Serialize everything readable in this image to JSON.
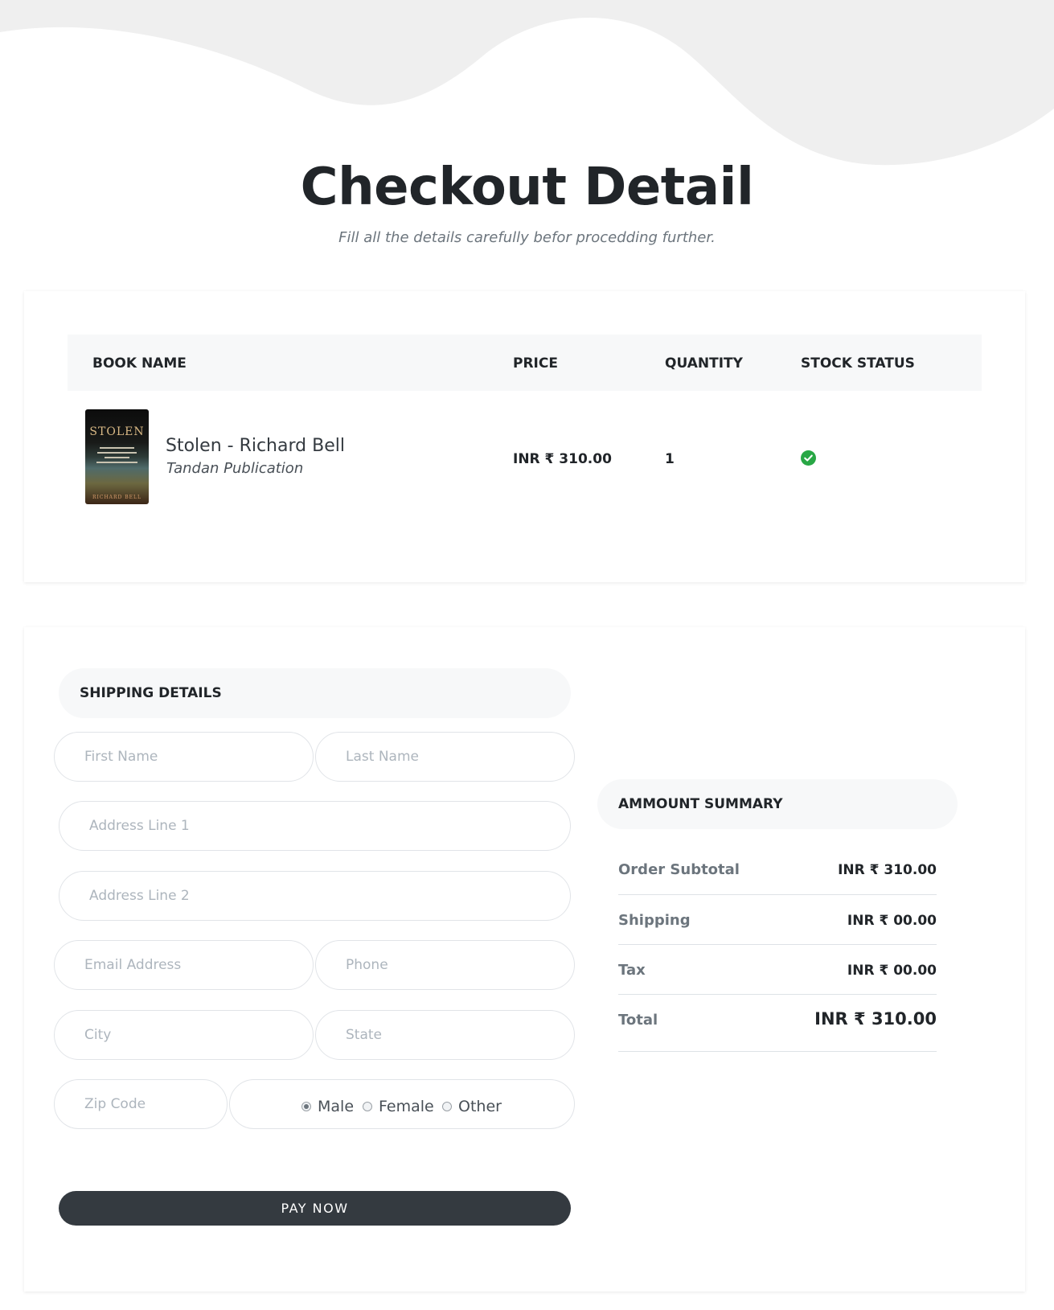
{
  "header": {
    "title": "Checkout Detail",
    "subtitle": "Fill all the details carefully befor procedding further."
  },
  "cart": {
    "columns": [
      "BOOK NAME",
      "PRICE",
      "QUANTITY",
      "STOCK STATUS"
    ],
    "item": {
      "name": "Stolen - Richard Bell",
      "publisher": "Tandan Publication",
      "price": "INR ₹ 310.00",
      "quantity": "1",
      "stock_status_icon": "check-circle-icon",
      "stock_status_color": "#28a745",
      "cover": {
        "title": "STOLEN",
        "author": "RICHARD BELL"
      }
    }
  },
  "shipping": {
    "heading": "SHIPPING DETAILS",
    "placeholders": {
      "first_name": "First Name",
      "last_name": "Last Name",
      "address1": "Address Line 1",
      "address2": "Address Line 2",
      "email": "Email Address",
      "phone": "Phone",
      "city": "City",
      "state": "State",
      "zip": "Zip Code"
    },
    "gender_options": [
      "Male",
      "Female",
      "Other"
    ],
    "gender_selected": "Male",
    "pay_button": "PAY NOW"
  },
  "summary": {
    "heading": "AMMOUNT SUMMARY",
    "rows": [
      {
        "label": "Order Subtotal",
        "value": "INR ₹ 310.00"
      },
      {
        "label": "Shipping",
        "value": "INR ₹ 00.00"
      },
      {
        "label": "Tax",
        "value": "INR ₹ 00.00"
      },
      {
        "label": "Total",
        "value": "INR ₹ 310.00"
      }
    ]
  },
  "colors": {
    "accent_dark": "#343a40",
    "wave": "#efefef",
    "success": "#28a745"
  }
}
